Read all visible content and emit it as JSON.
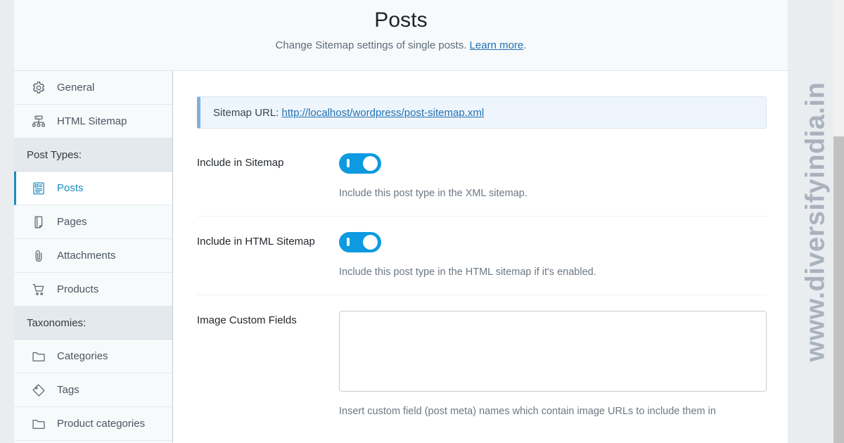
{
  "header": {
    "title": "Posts",
    "subtitle_prefix": "Change Sitemap settings of single posts. ",
    "subtitle_link": "Learn more",
    "subtitle_suffix": "."
  },
  "sidebar": {
    "items": [
      {
        "label": "General",
        "icon": "gear-icon",
        "type": "item",
        "active": false,
        "name": "sidebar-item-general"
      },
      {
        "label": "HTML Sitemap",
        "icon": "sitemap-icon",
        "type": "item",
        "active": false,
        "name": "sidebar-item-html-sitemap"
      },
      {
        "label": "Post Types:",
        "icon": "",
        "type": "section",
        "active": false,
        "name": "sidebar-section-post-types"
      },
      {
        "label": "Posts",
        "icon": "post-icon",
        "type": "item",
        "active": true,
        "name": "sidebar-item-posts"
      },
      {
        "label": "Pages",
        "icon": "page-icon",
        "type": "item",
        "active": false,
        "name": "sidebar-item-pages"
      },
      {
        "label": "Attachments",
        "icon": "paperclip-icon",
        "type": "item",
        "active": false,
        "name": "sidebar-item-attachments"
      },
      {
        "label": "Products",
        "icon": "cart-icon",
        "type": "item",
        "active": false,
        "name": "sidebar-item-products"
      },
      {
        "label": "Taxonomies:",
        "icon": "",
        "type": "section",
        "active": false,
        "name": "sidebar-section-taxonomies"
      },
      {
        "label": "Categories",
        "icon": "folder-icon",
        "type": "item",
        "active": false,
        "name": "sidebar-item-categories"
      },
      {
        "label": "Tags",
        "icon": "tag-icon",
        "type": "item",
        "active": false,
        "name": "sidebar-item-tags"
      },
      {
        "label": "Product categories",
        "icon": "folder-icon",
        "type": "item",
        "active": false,
        "name": "sidebar-item-product-categories"
      }
    ]
  },
  "notice": {
    "label": "Sitemap URL: ",
    "url": "http://localhost/wordpress/post-sitemap.xml"
  },
  "fields": [
    {
      "label": "Include in Sitemap",
      "control": "toggle",
      "value": "on",
      "help": "Include this post type in the XML sitemap."
    },
    {
      "label": "Include in HTML Sitemap",
      "control": "toggle",
      "value": "on",
      "help": "Include this post type in the HTML sitemap if it's enabled."
    },
    {
      "label": "Image Custom Fields",
      "control": "textarea",
      "value": "",
      "placeholder": "",
      "help": "Insert custom field (post meta) names which contain image URLs to include them in"
    }
  ],
  "watermark": {
    "text": "www.diversifyindia.in"
  },
  "colors": {
    "accent_blue": "#0d9ae0",
    "link_blue": "#2271b1",
    "active_blue": "#1e8cbe",
    "notice_bg": "#eef5fc",
    "notice_border": "#7fb0dd",
    "sidebar_bg": "#f6fafb",
    "section_bg": "#e3e9ec"
  }
}
